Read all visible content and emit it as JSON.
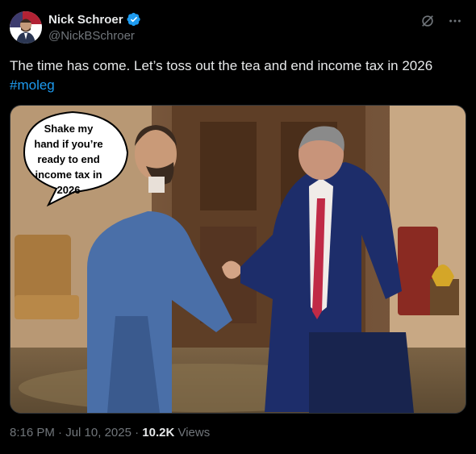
{
  "author": {
    "display_name": "Nick Schroer",
    "handle": "@NickBSchroer",
    "verified": true
  },
  "tweet": {
    "text": "The time has come. Let’s toss out the tea and end income tax in 2026",
    "hashtag": "#moleg"
  },
  "media": {
    "speech_bubble": {
      "line1": "Shake my",
      "line2": "hand if you’re",
      "line3": "ready to end",
      "line4": "income tax in",
      "line5": "2026"
    }
  },
  "meta": {
    "time": "8:16 PM",
    "sep1": " · ",
    "date": "Jul 10, 2025",
    "sep2": " · ",
    "views_count": "10.2K",
    "views_label": " Views"
  },
  "colors": {
    "accent": "#1d9bf0",
    "background": "#000000",
    "text": "#e7e9ea",
    "muted": "#71767b"
  },
  "icons": {
    "verified": "verified-badge-icon",
    "grok": "grok-icon",
    "more": "more-icon"
  }
}
